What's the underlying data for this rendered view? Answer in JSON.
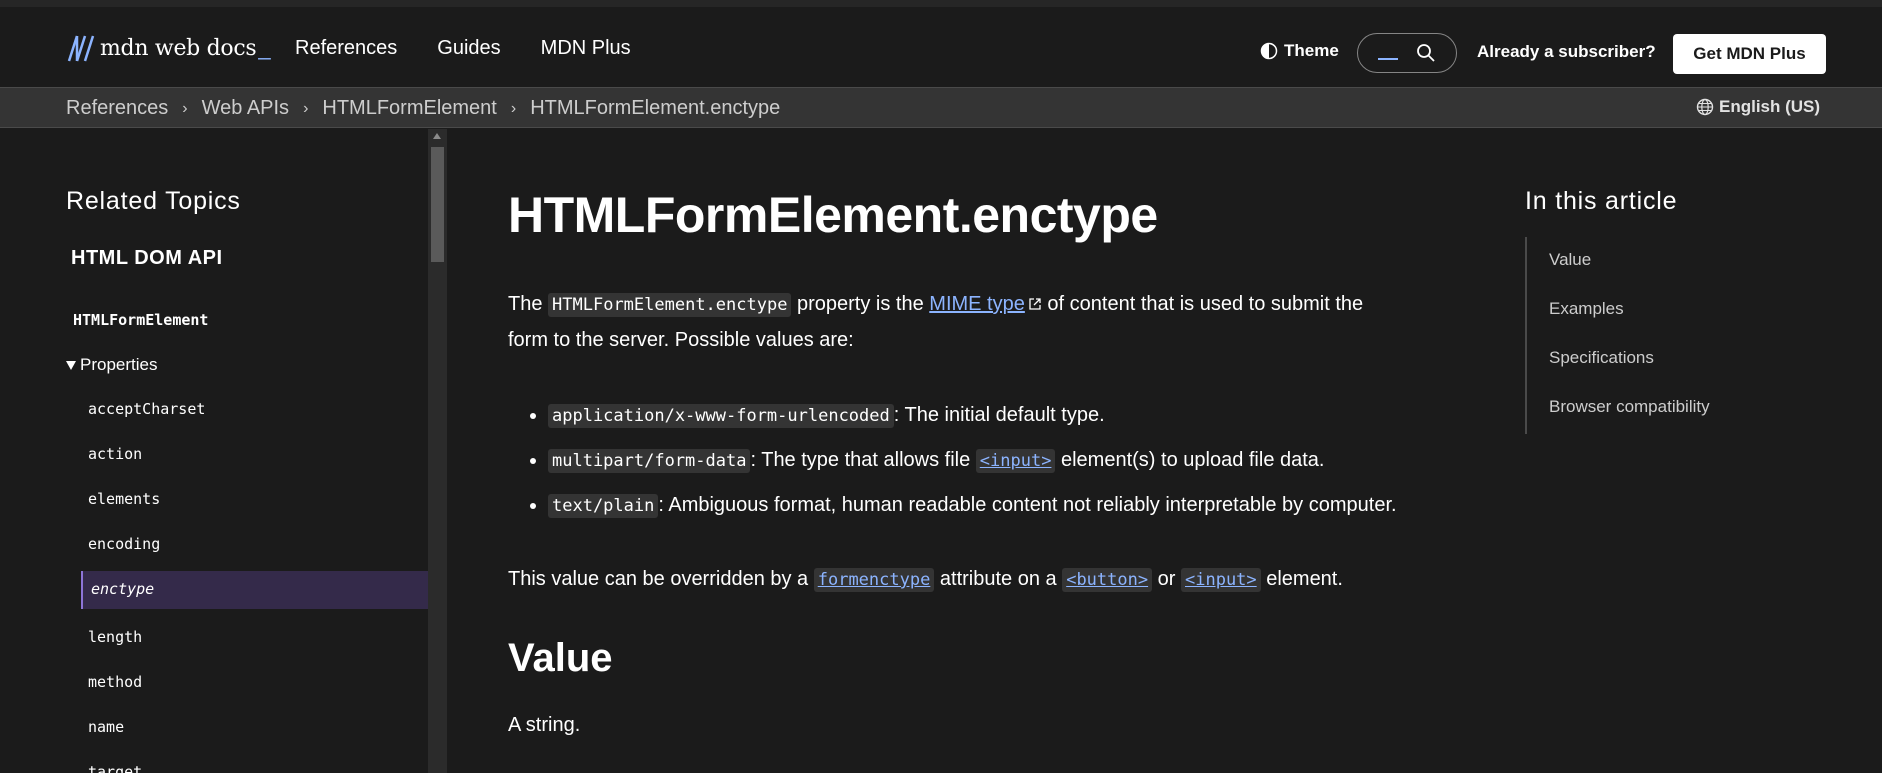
{
  "header": {
    "logo_text": "mdn web docs",
    "logo_underscore": "_",
    "nav": [
      "References",
      "Guides",
      "MDN Plus"
    ],
    "theme_label": "Theme",
    "subscriber_label": "Already a subscriber?",
    "get_plus_label": "Get MDN Plus"
  },
  "breadcrumb": [
    "References",
    "Web APIs",
    "HTMLFormElement",
    "HTMLFormElement.enctype"
  ],
  "language": "English (US)",
  "sidebar": {
    "title": "Related Topics",
    "api": "HTML DOM API",
    "interface": "HTMLFormElement",
    "properties_label": "Properties",
    "items": [
      "acceptCharset",
      "action",
      "elements",
      "encoding",
      "enctype",
      "length",
      "method",
      "name",
      "target"
    ],
    "active_item": "enctype"
  },
  "article": {
    "title": "HTMLFormElement.enctype",
    "intro_before": "The ",
    "intro_code": "HTMLFormElement.enctype",
    "intro_mid": " property is the ",
    "intro_link": "MIME type",
    "intro_after": " of content that is used to submit the",
    "intro_line2": "form to the server. Possible values are:",
    "values": [
      {
        "code": "application/x-www-form-urlencoded",
        "text_before": ": The initial default type.",
        "link": "",
        "text_after": ""
      },
      {
        "code": "multipart/form-data",
        "text_before": ": The type that allows file ",
        "link": "<input>",
        "text_after": " element(s) to upload file data."
      },
      {
        "code": "text/plain",
        "text_before": ": Ambiguous format, human readable content not reliably interpretable by computer.",
        "link": "",
        "text_after": ""
      }
    ],
    "override_before": "This value can be overridden by a ",
    "override_code1": "formenctype",
    "override_mid1": " attribute on a ",
    "override_code2": "<button>",
    "override_mid2": " or ",
    "override_code3": "<input>",
    "override_after": " element.",
    "value_heading": "Value",
    "value_text": "A string."
  },
  "toc": {
    "title": "In this article",
    "items": [
      "Value",
      "Examples",
      "Specifications",
      "Browser compatibility"
    ]
  },
  "colors": {
    "background": "#1b1b1b",
    "link": "#8cb4ff",
    "active_bg": "#342a4a",
    "active_border": "#8d74d8"
  }
}
